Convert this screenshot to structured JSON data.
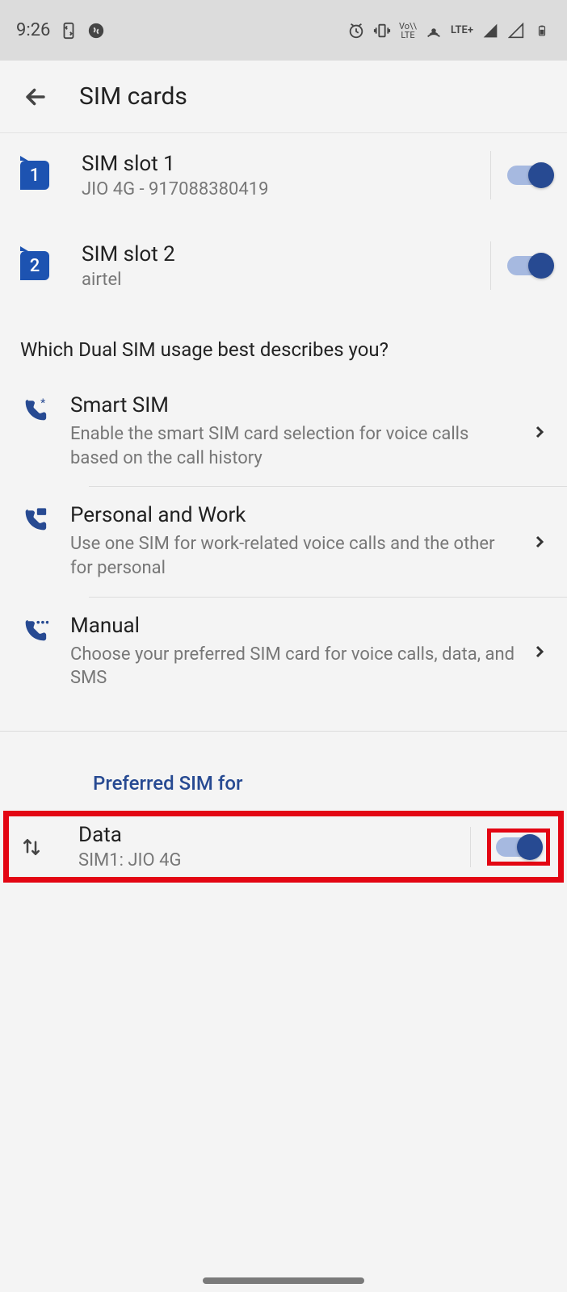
{
  "status": {
    "time": "9:26",
    "net_label": "LTE+"
  },
  "header": {
    "title": "SIM cards"
  },
  "sims": [
    {
      "badge": "1",
      "title": "SIM slot 1",
      "sub": "JIO 4G - 917088380419"
    },
    {
      "badge": "2",
      "title": "SIM slot 2",
      "sub": "airtel"
    }
  ],
  "usage_heading": "Which Dual SIM usage best describes you?",
  "usage": [
    {
      "title": "Smart SIM",
      "desc": "Enable the smart SIM card selection for voice calls based on the call history"
    },
    {
      "title": "Personal and Work",
      "desc": "Use one SIM for work-related voice calls and the other for personal"
    },
    {
      "title": "Manual",
      "desc": "Choose your preferred SIM card for voice calls, data, and SMS"
    }
  ],
  "preferred_heading": "Preferred SIM for",
  "data": {
    "title": "Data",
    "sub": "SIM1: JIO 4G"
  }
}
